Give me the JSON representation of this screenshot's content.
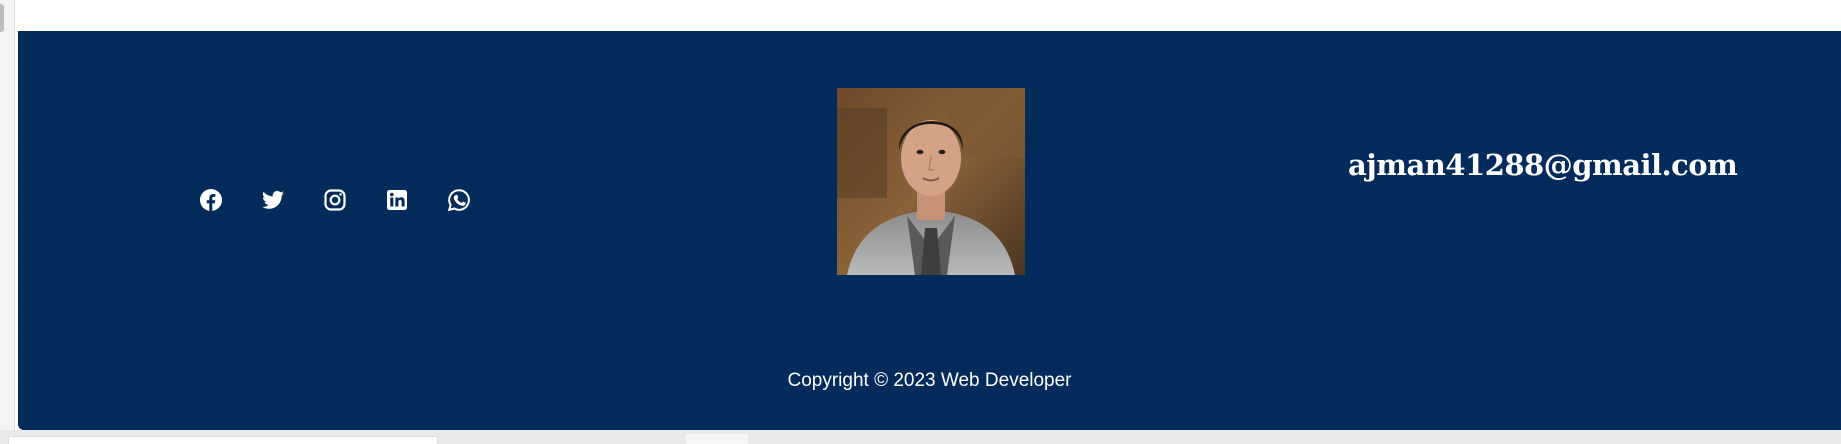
{
  "footer": {
    "background_color": "#022b5c",
    "social_links": [
      {
        "icon": "facebook-icon",
        "name": "Facebook"
      },
      {
        "icon": "twitter-icon",
        "name": "Twitter"
      },
      {
        "icon": "instagram-icon",
        "name": "Instagram"
      },
      {
        "icon": "linkedin-icon",
        "name": "LinkedIn"
      },
      {
        "icon": "whatsapp-icon",
        "name": "WhatsApp"
      }
    ],
    "avatar": {
      "alt": "profile-photo"
    },
    "email": "ajman41288@gmail.com",
    "copyright": "Copyright © 2023 Web Developer"
  }
}
